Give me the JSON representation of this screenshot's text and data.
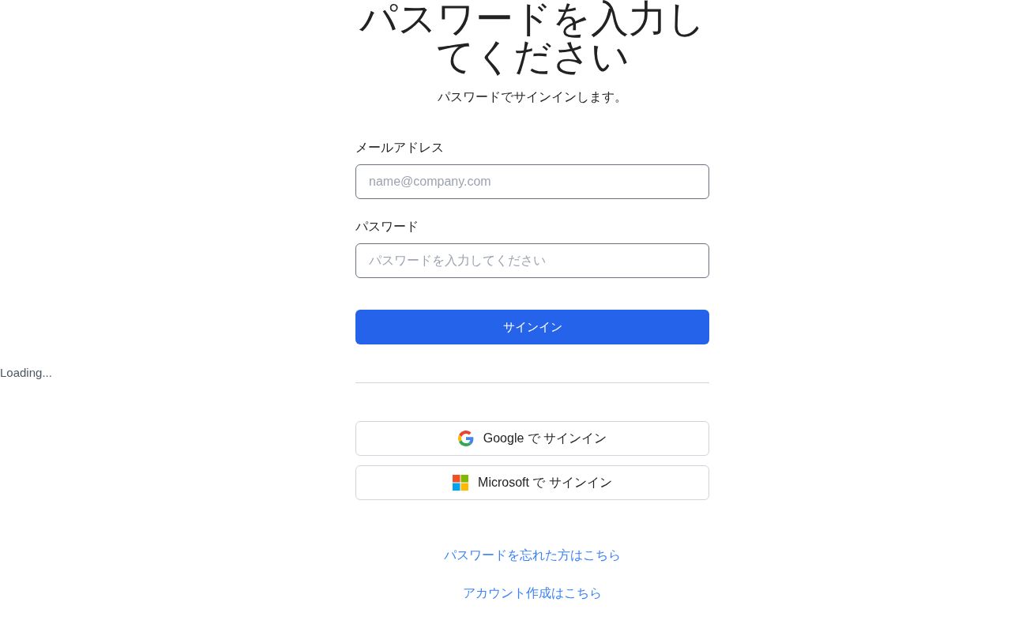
{
  "title": "パスワードを入力してください",
  "subtitle": "パスワードでサインインします。",
  "fields": [
    {
      "label": "メールアドレス",
      "placeholder": "name@company.com"
    },
    {
      "label": "パスワード",
      "placeholder": "パスワードを入力してください"
    }
  ],
  "submit": "サインイン",
  "loading": "Loading...",
  "social_buttons": [
    {
      "kind": "google",
      "label": "Google で サインイン"
    },
    {
      "kind": "microsoft",
      "label": "Microsoft で サインイン"
    }
  ],
  "links": [
    "パスワードを忘れた方はこちら",
    "アカウント作成はこちら"
  ]
}
